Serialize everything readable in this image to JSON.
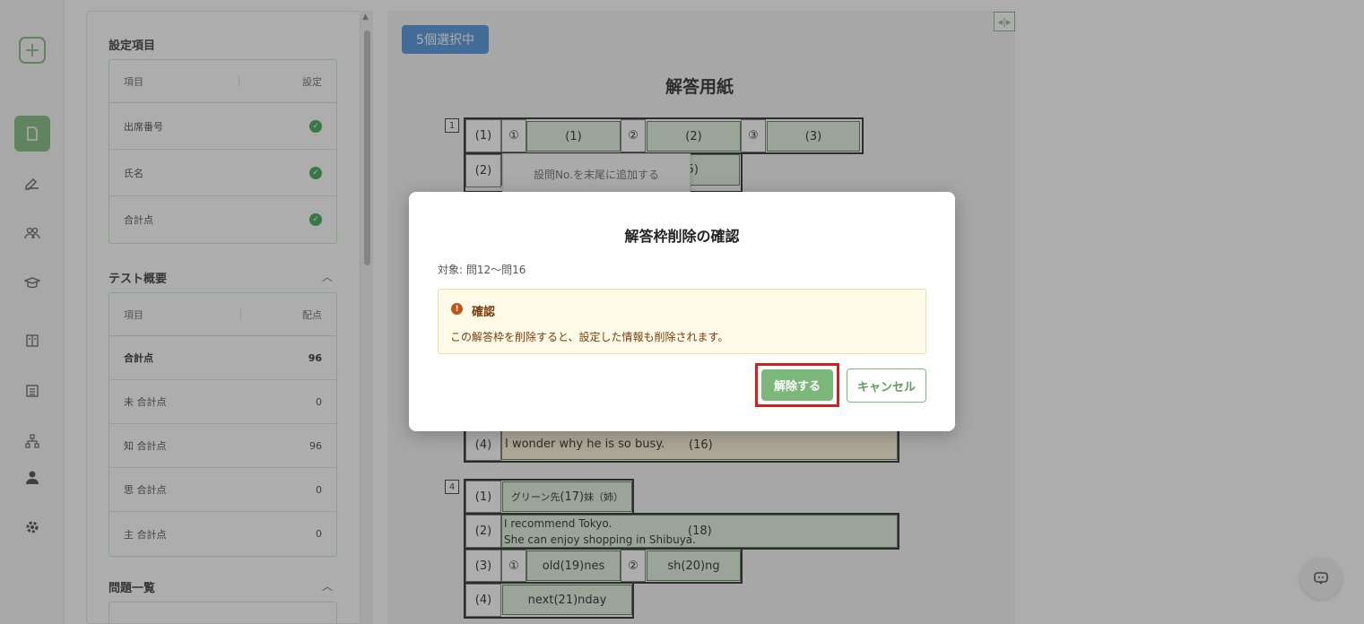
{
  "rail": {
    "add": "+",
    "icons": [
      "document-icon",
      "pen-icon",
      "group-icon",
      "graduation-icon",
      "book-icon",
      "list-icon",
      "hierarchy-icon",
      "user-icon",
      "gear-icon"
    ]
  },
  "settings": {
    "section_title": "設定項目",
    "col_item": "項目",
    "col_setting": "設定",
    "rows": [
      "出席番号",
      "氏名",
      "合計点"
    ]
  },
  "overview": {
    "section_title": "テスト概要",
    "col_item": "項目",
    "col_score": "配点",
    "rows": [
      {
        "label": "合計点",
        "value": "96"
      },
      {
        "label": "未 合計点",
        "value": "0"
      },
      {
        "label": "知 合計点",
        "value": "96"
      },
      {
        "label": "思 合計点",
        "value": "0"
      },
      {
        "label": "主 合計点",
        "value": "0"
      }
    ]
  },
  "problems": {
    "section_title": "問題一覧"
  },
  "canvas": {
    "badge": "5個選択中",
    "title": "解答用紙",
    "context_menu": "設問No.を末尾に追加する",
    "q1": {
      "num": "1",
      "sub1": "(1)",
      "sub2": "(2)",
      "c1": "①",
      "c2": "②",
      "c3": "③",
      "a1": "(1)",
      "a2": "(2)",
      "a3": "(3)",
      "a5": "5)"
    },
    "q3": {
      "sub4": "(4)",
      "text": "I wonder why he is so busy.",
      "a16": "(16)"
    },
    "q4": {
      "num": "4",
      "sub1": "(1)",
      "sub2": "(2)",
      "sub3": "(3)",
      "sub4": "(4)",
      "t17": "グリーン先",
      "a17": "(17)",
      "t17b": "妹（姉）",
      "t18a": "I recommend Tokyo.",
      "t18b": "She can enjoy shopping in Shibuya.",
      "a18": "(18)",
      "c1": "①",
      "c2": "②",
      "t19a": "old",
      "a19": "(19)",
      "t19b": "nes",
      "t20a": "sh",
      "a20": "(20)",
      "t20b": "ng",
      "t21a": "next",
      "a21": "(21)",
      "t21b": "nday"
    }
  },
  "dialog": {
    "title": "解答枠削除の確認",
    "target": "対象: 問12〜問16",
    "alert_icon": "!",
    "alert_title": "確認",
    "alert_message": "この解答枠を削除すると、設定した情報も削除されます。",
    "confirm_label": "解除する",
    "cancel_label": "キャンセル"
  }
}
